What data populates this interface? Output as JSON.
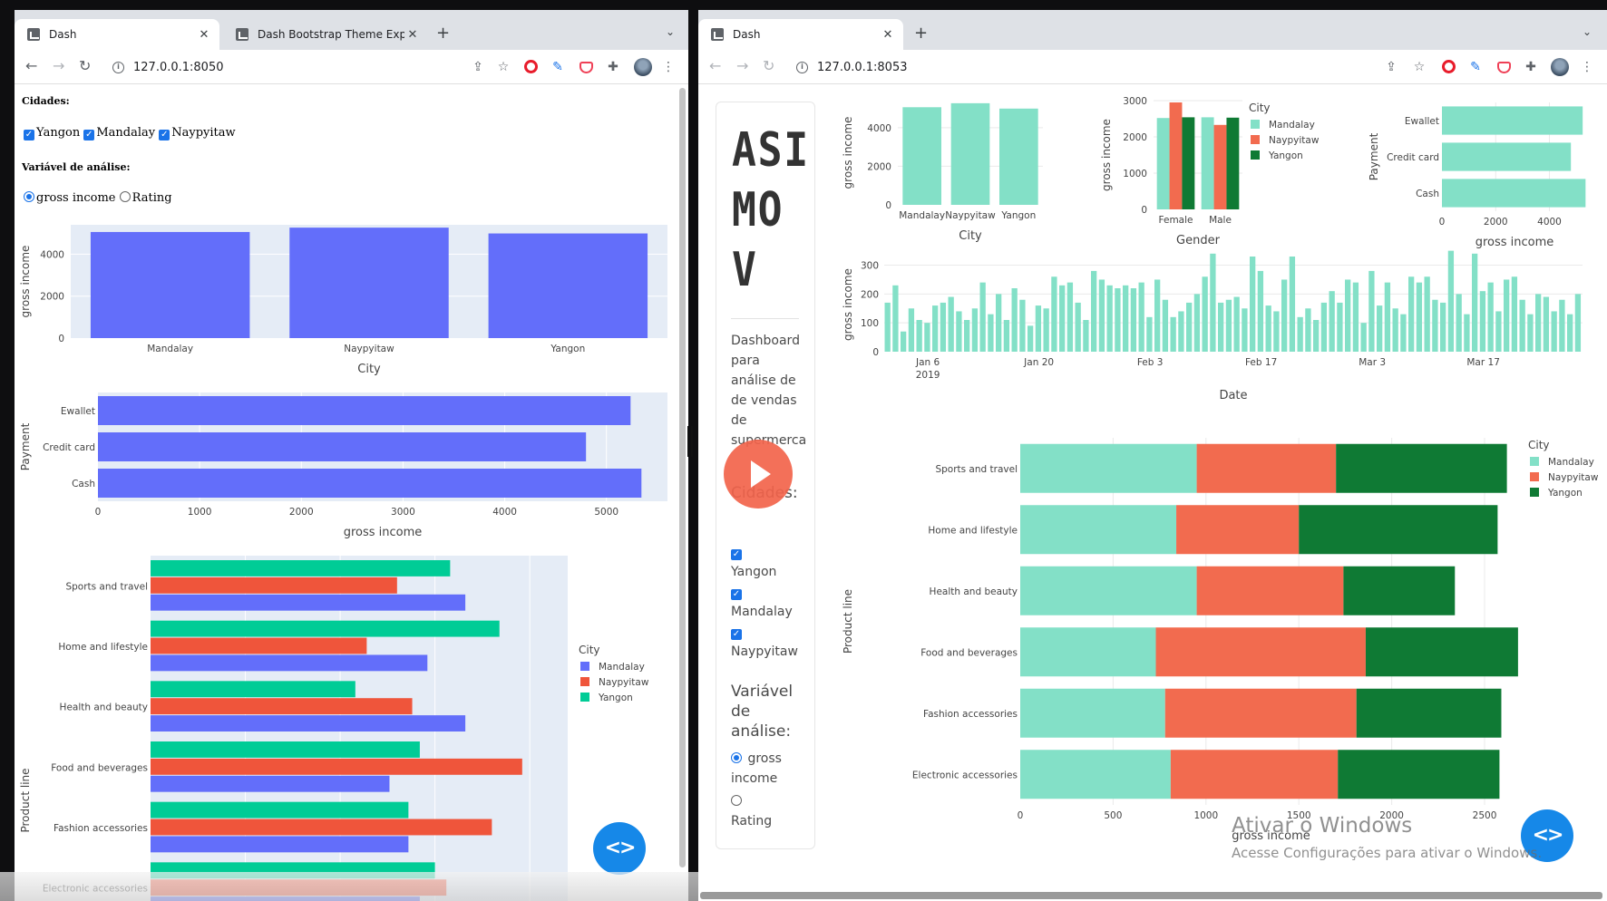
{
  "left": {
    "tabs": [
      {
        "title": "Dash",
        "active": true
      },
      {
        "title": "Dash Bootstrap Theme Explore",
        "active": false
      }
    ],
    "url": "127.0.0.1:8050",
    "cidades_label": "Cidades:",
    "checkboxes": [
      {
        "label": "Yangon",
        "checked": true
      },
      {
        "label": "Mandalay",
        "checked": true
      },
      {
        "label": "Naypyitaw",
        "checked": true
      }
    ],
    "variavel_label": "Variável de análise:",
    "radios": [
      {
        "label": "gross income",
        "selected": true
      },
      {
        "label": "Rating",
        "selected": false
      }
    ]
  },
  "right": {
    "tabs": [
      {
        "title": "Dash",
        "active": true
      }
    ],
    "url": "127.0.0.1:8053",
    "logo": [
      "ASI",
      "MO",
      "V"
    ],
    "description": "Dashboard para análise de de vendas de supermercado",
    "cidades_label": "Cidades:",
    "checkboxes": [
      {
        "label": "Yangon",
        "checked": true
      },
      {
        "label": "Mandalay",
        "checked": true
      },
      {
        "label": "Naypyitaw",
        "checked": true
      }
    ],
    "variavel_label": "Variável de análise:",
    "radios": [
      {
        "label": "gross income",
        "selected": true
      },
      {
        "label": "Rating",
        "selected": false
      }
    ]
  },
  "watermark": {
    "title": "Ativar o Windows",
    "subtitle": "Acesse Configurações para ativar o Windows."
  },
  "colors": {
    "blue": "#636efa",
    "red": "#ef553b",
    "green": "#00cc96",
    "mint": "#83e0c7",
    "coral": "#f26b4f",
    "darkgreen": "#0f7a34",
    "plotbg": "#e5ecf6"
  },
  "chart_data": [
    {
      "id": "L1",
      "type": "bar",
      "categories": [
        "Mandalay",
        "Naypyitaw",
        "Yangon"
      ],
      "values": [
        5057,
        5265,
        4987
      ],
      "xlabel": "City",
      "ylabel": "gross income",
      "yticks": [
        0,
        2000,
        4000
      ],
      "ylim": [
        0,
        5400
      ]
    },
    {
      "id": "L2",
      "type": "bar",
      "orientation": "h",
      "categories": [
        "Ewallet",
        "Credit card",
        "Cash"
      ],
      "values": [
        5237,
        4799,
        5344
      ],
      "xlabel": "gross income",
      "ylabel": "Payment",
      "xticks": [
        0,
        1000,
        2000,
        3000,
        4000,
        5000
      ],
      "xlim": [
        0,
        5600
      ]
    },
    {
      "id": "L3",
      "type": "bar",
      "orientation": "h",
      "categories": [
        "Sports and travel",
        "Home and lifestyle",
        "Health and beauty",
        "Food and beverages",
        "Fashion accessories",
        "Electronic accessories"
      ],
      "legend_title": "City",
      "series": [
        {
          "name": "Mandalay",
          "values": [
            830,
            730,
            830,
            630,
            680,
            710
          ]
        },
        {
          "name": "Naypyitaw",
          "values": [
            650,
            570,
            690,
            980,
            900,
            780
          ]
        },
        {
          "name": "Yangon",
          "values": [
            790,
            920,
            540,
            710,
            680,
            750
          ]
        }
      ]
    },
    {
      "id": "R1",
      "type": "bar",
      "categories": [
        "Mandalay",
        "Naypyitaw",
        "Yangon"
      ],
      "values": [
        5057,
        5265,
        4987
      ],
      "xlabel": "City",
      "ylabel": "gross income",
      "yticks": [
        0,
        2000,
        4000
      ],
      "ylim": [
        0,
        5400
      ]
    },
    {
      "id": "R2",
      "type": "bar",
      "categories": [
        "Female",
        "Male"
      ],
      "xlabel": "Gender",
      "ylabel": "gross income",
      "yticks": [
        0,
        1000,
        2000,
        3000
      ],
      "ylim": [
        0,
        3000
      ],
      "legend_title": "City",
      "series": [
        {
          "name": "Mandalay",
          "values": [
            2520,
            2540
          ]
        },
        {
          "name": "Naypyitaw",
          "values": [
            2950,
            2330
          ]
        },
        {
          "name": "Yangon",
          "values": [
            2540,
            2530
          ]
        }
      ]
    },
    {
      "id": "R3",
      "type": "bar",
      "orientation": "h",
      "categories": [
        "Ewallet",
        "Credit card",
        "Cash"
      ],
      "values": [
        5237,
        4799,
        5344
      ],
      "xlabel": "gross income",
      "ylabel": "Payment",
      "xticks": [
        0,
        2000,
        4000
      ],
      "xlim": [
        0,
        5400
      ]
    },
    {
      "id": "R4",
      "type": "bar",
      "xlabel": "Date",
      "ylabel": "gross income",
      "yticks": [
        0,
        100,
        200,
        300
      ],
      "ylim": [
        0,
        330
      ],
      "start_date": "2019-01-01",
      "xticks": [
        {
          "label": "Jan 6",
          "sub": "2019",
          "day": 5
        },
        {
          "label": "Jan 20",
          "day": 19
        },
        {
          "label": "Feb 3",
          "day": 33
        },
        {
          "label": "Feb 17",
          "day": 47
        },
        {
          "label": "Mar 3",
          "day": 61
        },
        {
          "label": "Mar 17",
          "day": 75
        }
      ],
      "values": [
        170,
        230,
        70,
        150,
        110,
        100,
        160,
        170,
        190,
        140,
        110,
        150,
        240,
        130,
        200,
        110,
        220,
        180,
        90,
        160,
        150,
        260,
        230,
        240,
        170,
        110,
        280,
        250,
        230,
        220,
        230,
        220,
        240,
        120,
        250,
        180,
        120,
        140,
        170,
        200,
        260,
        340,
        170,
        180,
        190,
        150,
        330,
        280,
        160,
        140,
        250,
        330,
        120,
        150,
        110,
        170,
        210,
        170,
        250,
        240,
        100,
        280,
        160,
        240,
        150,
        130,
        260,
        240,
        260,
        180,
        170,
        350,
        200,
        130,
        340,
        210,
        240,
        140,
        250,
        260,
        180,
        130,
        200,
        190,
        140,
        180,
        130,
        200
      ]
    },
    {
      "id": "R5",
      "type": "bar",
      "orientation": "h",
      "stacked": true,
      "categories": [
        "Sports and travel",
        "Home and lifestyle",
        "Health and beauty",
        "Food and beverages",
        "Fashion accessories",
        "Electronic accessories"
      ],
      "xlabel": "gross income",
      "ylabel": "Product line",
      "xticks": [
        0,
        500,
        1000,
        1500,
        2000,
        2500
      ],
      "xlim": [
        0,
        2700
      ],
      "legend_title": "City",
      "series": [
        {
          "name": "Mandalay",
          "values": [
            950,
            840,
            950,
            730,
            780,
            810
          ]
        },
        {
          "name": "Naypyitaw",
          "values": [
            750,
            660,
            790,
            1130,
            1030,
            900
          ]
        },
        {
          "name": "Yangon",
          "values": [
            920,
            1070,
            600,
            820,
            780,
            870
          ]
        }
      ]
    }
  ]
}
